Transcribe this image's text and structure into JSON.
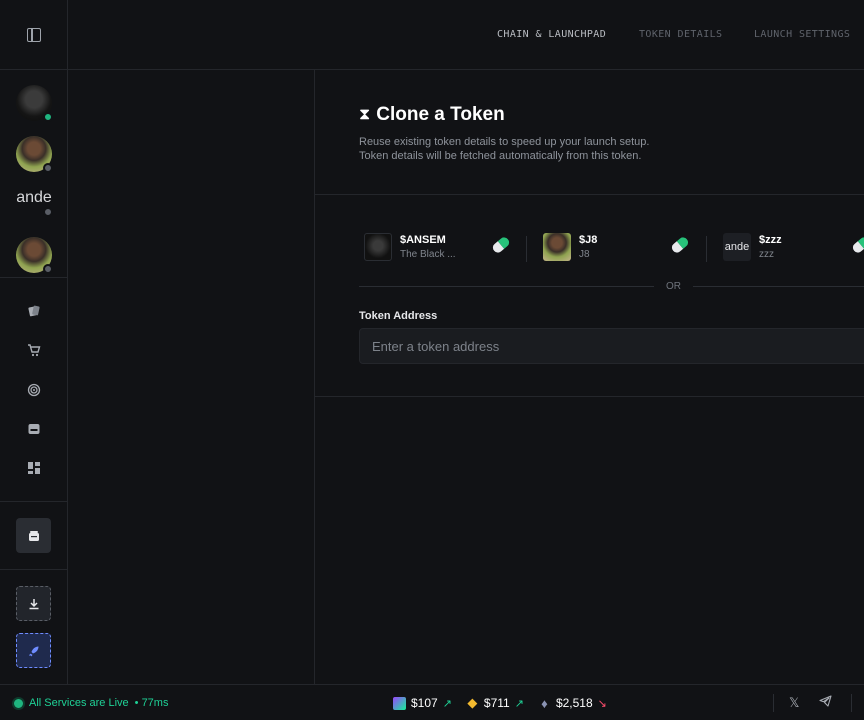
{
  "header": {
    "tabs": [
      {
        "label": "CHAIN & LAUNCHPAD",
        "active": true
      },
      {
        "label": "TOKEN DETAILS",
        "active": false
      },
      {
        "label": "LAUNCH SETTINGS",
        "active": false
      }
    ]
  },
  "sidebar": {
    "avatars": [
      {
        "name": "",
        "status": "online"
      },
      {
        "name": "",
        "status": "offline"
      },
      {
        "name": "ande",
        "status": "offline"
      },
      {
        "name": "",
        "status": "offline"
      }
    ],
    "nav_icons": [
      "cards-icon",
      "cart-icon",
      "radar-icon",
      "inbox-icon",
      "dashboard-icon"
    ]
  },
  "clone": {
    "title": "Clone a Token",
    "description_line1": "Reuse existing token details to speed up your launch setup.",
    "description_line2": "Token details will be fetched automatically from this token.",
    "tokens": [
      {
        "symbol": "$ANSEM",
        "name": "The Black ...",
        "image_text": ""
      },
      {
        "symbol": "$J8",
        "name": "J8",
        "image_text": ""
      },
      {
        "symbol": "$zzz",
        "name": "zzz",
        "image_text": "ande"
      }
    ],
    "or_label": "OR",
    "address_label": "Token Address",
    "address_placeholder": "Enter a token address",
    "address_value": ""
  },
  "footer": {
    "status_text": "All Services are Live",
    "latency": "• 77ms",
    "prices": [
      {
        "coin": "SOL",
        "value": "$107",
        "trend": "up"
      },
      {
        "coin": "BNB",
        "value": "$711",
        "trend": "up"
      },
      {
        "coin": "ETH",
        "value": "$2,518",
        "trend": "down"
      }
    ]
  },
  "colors": {
    "background": "#111215",
    "accent_green": "#1fd196",
    "accent_red": "#ff4d6d",
    "accent_blue": "#6f8cff"
  }
}
